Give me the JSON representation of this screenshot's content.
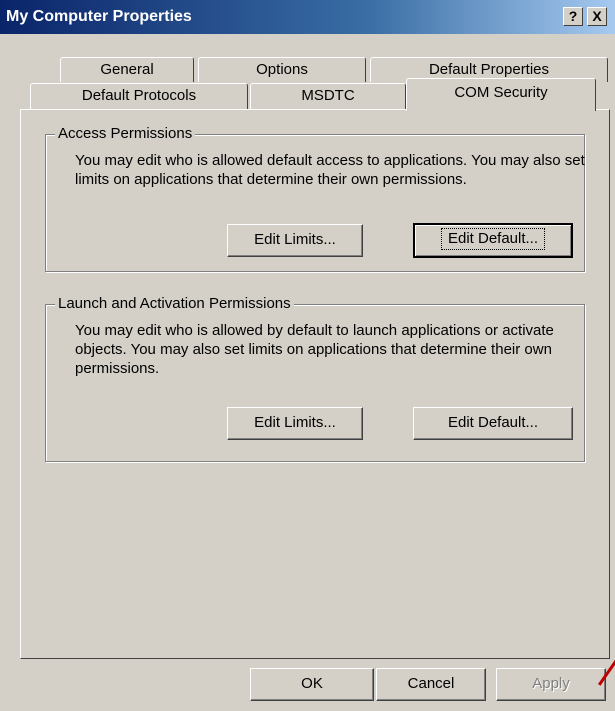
{
  "window": {
    "title": "My Computer Properties",
    "help_button": "?",
    "close_button": "X"
  },
  "tabs_back": [
    {
      "label": "General"
    },
    {
      "label": "Options"
    },
    {
      "label": "Default Properties"
    }
  ],
  "tabs_front": [
    {
      "label": "Default Protocols"
    },
    {
      "label": "MSDTC"
    },
    {
      "label": "COM Security",
      "active": true
    }
  ],
  "access": {
    "title": "Access Permissions",
    "description": "You may edit who is allowed default access to applications. You may also set limits on applications that determine their own permissions.",
    "edit_limits": "Edit Limits...",
    "edit_default": "Edit Default..."
  },
  "launch": {
    "title": "Launch and Activation Permissions",
    "description": "You may edit who is allowed by default to launch applications or activate objects. You may also set limits on applications that determine their own permissions.",
    "edit_limits": "Edit Limits...",
    "edit_default": "Edit Default..."
  },
  "footer": {
    "ok": "OK",
    "cancel": "Cancel",
    "apply": "Apply"
  },
  "colors": {
    "titlebar_start": "#0a246a",
    "face": "#d4d0c8",
    "annotation_arrow": "#c00000"
  }
}
